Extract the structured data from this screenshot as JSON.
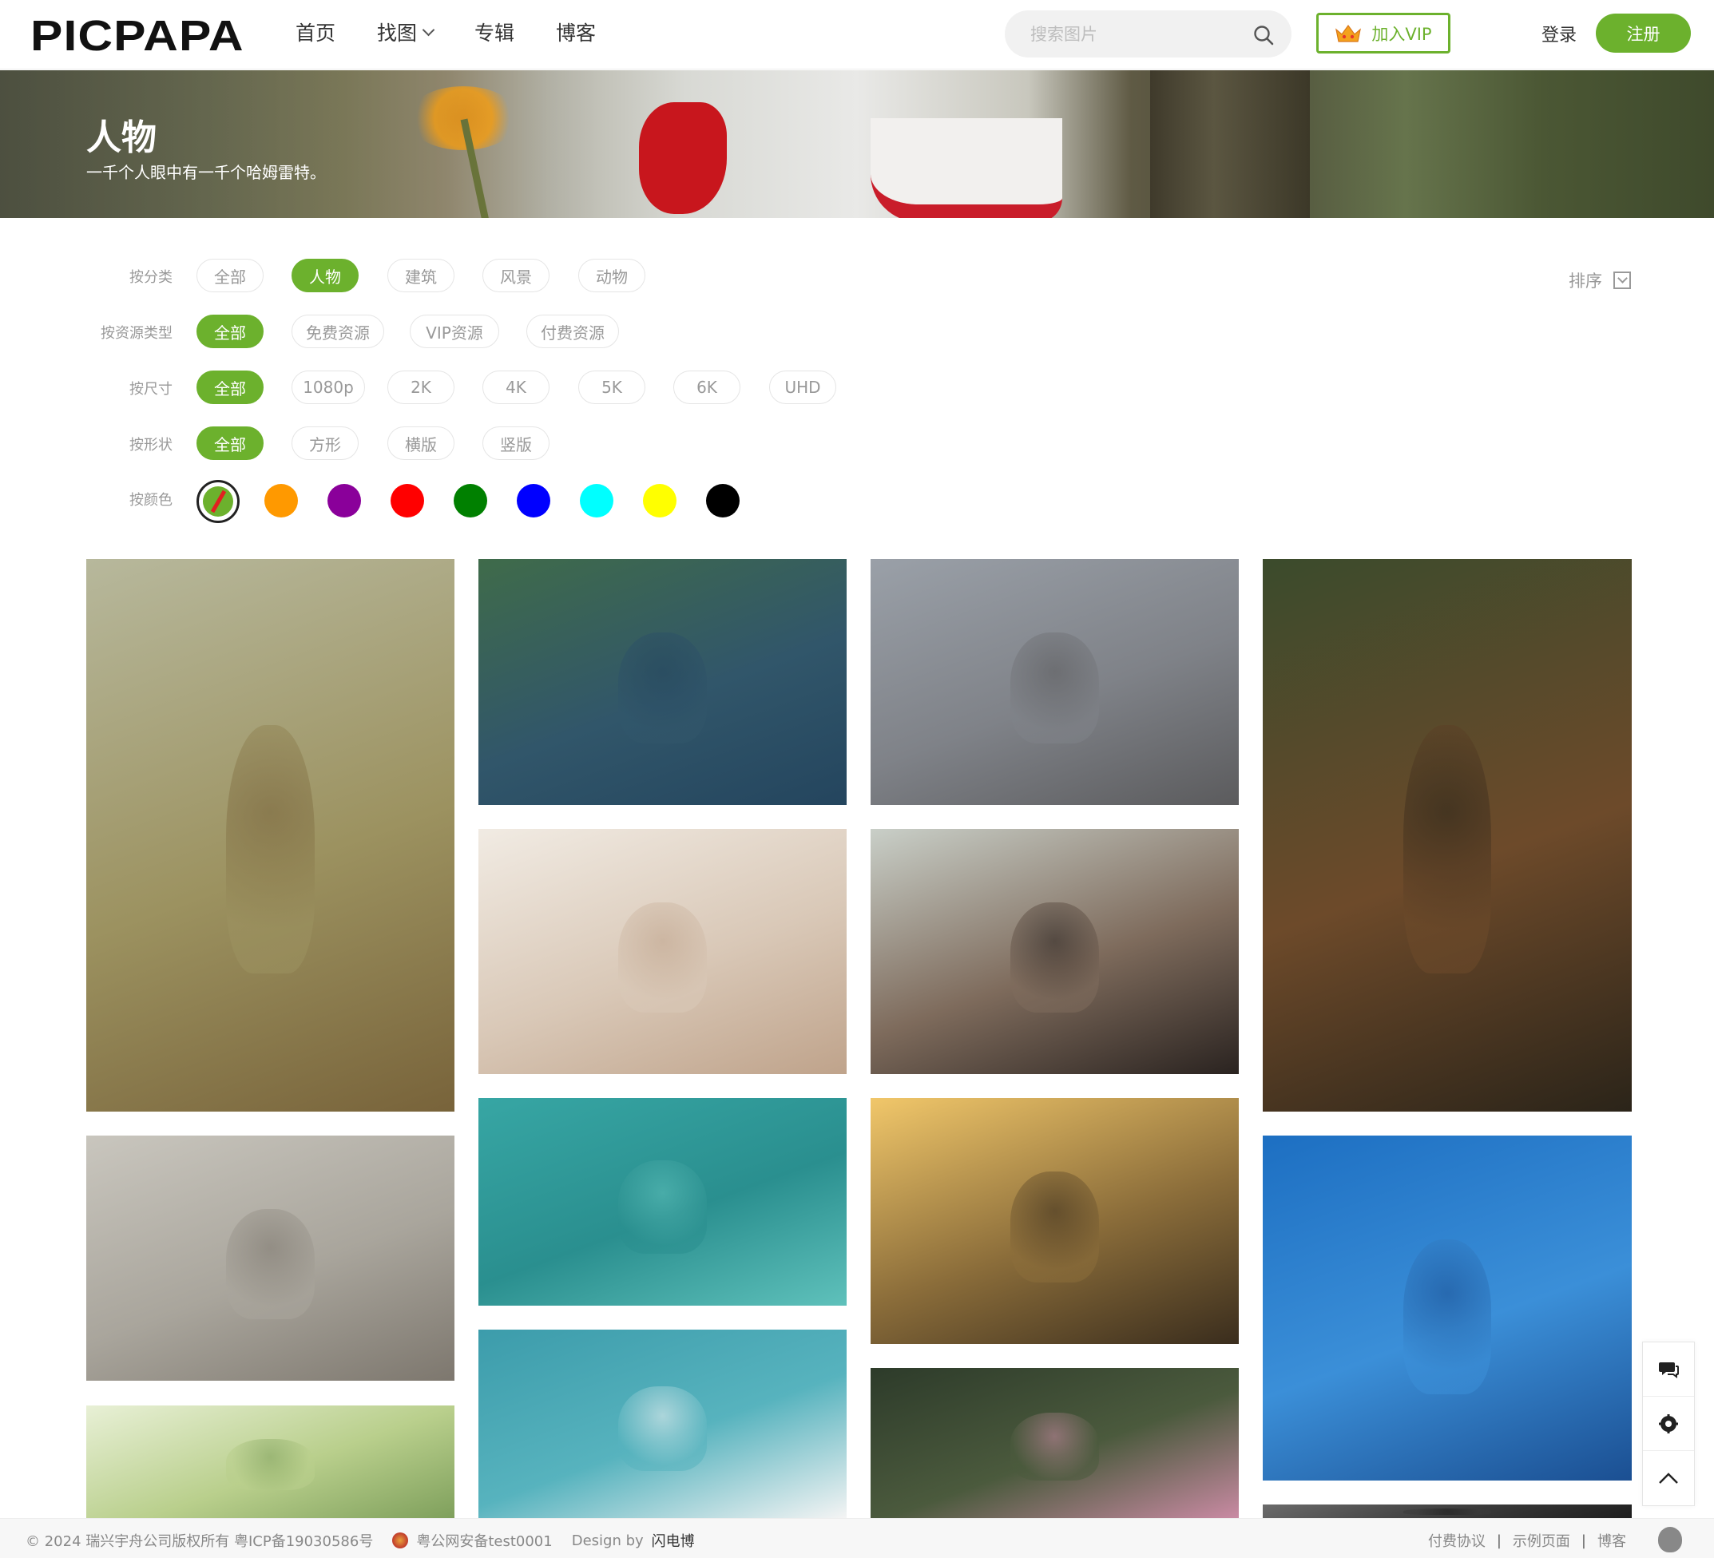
{
  "header": {
    "logo": "PICPAPA",
    "nav": [
      {
        "label": "首页"
      },
      {
        "label": "找图",
        "dropdown": true
      },
      {
        "label": "专辑"
      },
      {
        "label": "博客"
      }
    ],
    "search": {
      "placeholder": "搜索图片"
    },
    "vip_label": "加入VIP",
    "login_label": "登录",
    "register_label": "注册"
  },
  "banner": {
    "title": "人物",
    "subtitle": "一千个人眼中有一千个哈姆雷特。"
  },
  "filters": {
    "category": {
      "label": "按分类",
      "options": [
        "全部",
        "人物",
        "建筑",
        "风景",
        "动物"
      ],
      "active": "人物"
    },
    "resource": {
      "label": "按资源类型",
      "options": [
        "全部",
        "免费资源",
        "VIP资源",
        "付费资源"
      ],
      "active": "全部"
    },
    "size": {
      "label": "按尺寸",
      "options": [
        "全部",
        "1080p",
        "2K",
        "4K",
        "5K",
        "6K",
        "UHD"
      ],
      "active": "全部"
    },
    "shape": {
      "label": "按形状",
      "options": [
        "全部",
        "方形",
        "横版",
        "竖版"
      ],
      "active": "全部"
    },
    "color": {
      "label": "按颜色",
      "swatches": [
        "#ff9900",
        "#8a009a",
        "#ff0000",
        "#008000",
        "#0000ff",
        "#00ffff",
        "#ffff00",
        "#000000"
      ]
    },
    "sort_label": "排序"
  },
  "gallery": [
    {
      "name": "photo-selfie-friends",
      "colors": [
        "#b7b89c",
        "#9c9260",
        "#78633a"
      ]
    },
    {
      "name": "photo-infinity-pool",
      "colors": [
        "#3f6b4a",
        "#31566a",
        "#24455e"
      ]
    },
    {
      "name": "photo-mother-child-street",
      "colors": [
        "#9aa0a8",
        "#7f8288",
        "#5b5b5d"
      ]
    },
    {
      "name": "photo-curly-hair-portrait",
      "colors": [
        "#3b4b2c",
        "#6d4a2a",
        "#2b2419"
      ]
    },
    {
      "name": "photo-bathtub-woman",
      "colors": [
        "#f1ebe3",
        "#d9c8b7",
        "#bfa38b"
      ]
    },
    {
      "name": "photo-couple-smiling",
      "colors": [
        "#c9cfc8",
        "#7e6b5c",
        "#2a2320"
      ]
    },
    {
      "name": "photo-beach-reflection",
      "colors": [
        "#c9c6be",
        "#a9a59c",
        "#7d776e"
      ]
    },
    {
      "name": "photo-floating-turquoise",
      "colors": [
        "#37a6a4",
        "#2a8f8f",
        "#5fc1bb"
      ]
    },
    {
      "name": "photo-sunset-lake",
      "colors": [
        "#f1c76a",
        "#8b6d3a",
        "#3a2d1d"
      ]
    },
    {
      "name": "photo-blue-pool-dancers",
      "colors": [
        "#1d6fc2",
        "#3b8fd8",
        "#1b4f92"
      ]
    },
    {
      "name": "photo-green-blur",
      "colors": [
        "#e8f0d6",
        "#b9cf8c",
        "#7fa05c"
      ]
    },
    {
      "name": "photo-pool-tiles",
      "colors": [
        "#3c9cab",
        "#57b3be",
        "#f4f4f4"
      ]
    },
    {
      "name": "photo-pink-flowers",
      "colors": [
        "#2d3b2a",
        "#4b5a3d",
        "#c98aa3"
      ]
    },
    {
      "name": "photo-dark-partial",
      "colors": [
        "#6b6b6b",
        "#3a3a3a",
        "#1e1e1e"
      ]
    }
  ],
  "footer": {
    "copyright": "© 2024 瑞兴宇舟公司版权所有 粤ICP备19030586号",
    "police": "粤公网安备test0001",
    "design_prefix": "Design by",
    "design_author": "闪电博",
    "links": [
      "付费协议",
      "示例页面",
      "博客"
    ]
  }
}
